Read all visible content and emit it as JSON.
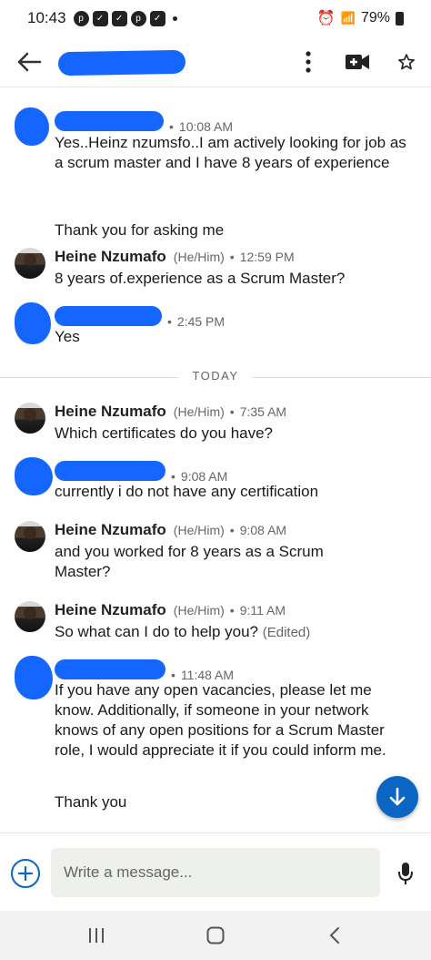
{
  "status_bar": {
    "time": "10:43",
    "battery": "79%"
  },
  "header": {
    "back_icon": "arrow-left-icon",
    "more_icon": "more-vertical-icon",
    "video_icon": "video-call-icon",
    "star_icon": "star-outline-icon"
  },
  "messages": [
    {
      "sender": "",
      "time": "10:08 AM",
      "text": "Yes..Heinz nzumsfo..I am actively looking for job as a scrum master and I have 8 years of experience",
      "text2": "Thank you for asking me"
    },
    {
      "sender": "Heine Nzumafo",
      "pronouns": "(He/Him)",
      "time": "12:59 PM",
      "text": "8 years of.experience as a Scrum Master?"
    },
    {
      "sender": "",
      "time": "2:45 PM",
      "text": "Yes"
    },
    {
      "sender": "Heine Nzumafo",
      "pronouns": "(He/Him)",
      "time": "7:35 AM",
      "text": "Which certificates do you have?"
    },
    {
      "sender": "",
      "time": "9:08 AM",
      "text": "currently i do not have any certification"
    },
    {
      "sender": "Heine Nzumafo",
      "pronouns": "(He/Him)",
      "time": "9:08 AM",
      "text": "and you worked for 8 years as a Scrum Master?"
    },
    {
      "sender": "Heine Nzumafo",
      "pronouns": "(He/Him)",
      "time": "9:11 AM",
      "text": "So what can I do to help you?",
      "edited": "(Edited)"
    },
    {
      "sender": "",
      "time": "11:48 AM",
      "text": "If you have any open vacancies, please let me know. Additionally, if someone in your network knows of any open positions for a Scrum Master role, I would appreciate it if you could inform me.",
      "text2": "Thank you"
    }
  ],
  "divider": {
    "label": "TODAY"
  },
  "composer": {
    "placeholder": "Write a message...",
    "add_icon": "plus-icon",
    "mic_icon": "microphone-icon"
  },
  "nav": {
    "recents_icon": "recents-icon",
    "home_icon": "home-icon",
    "back_icon": "back-chevron-icon"
  },
  "colors": {
    "accent": "#0a66c2",
    "redaction": "#1466ff"
  }
}
